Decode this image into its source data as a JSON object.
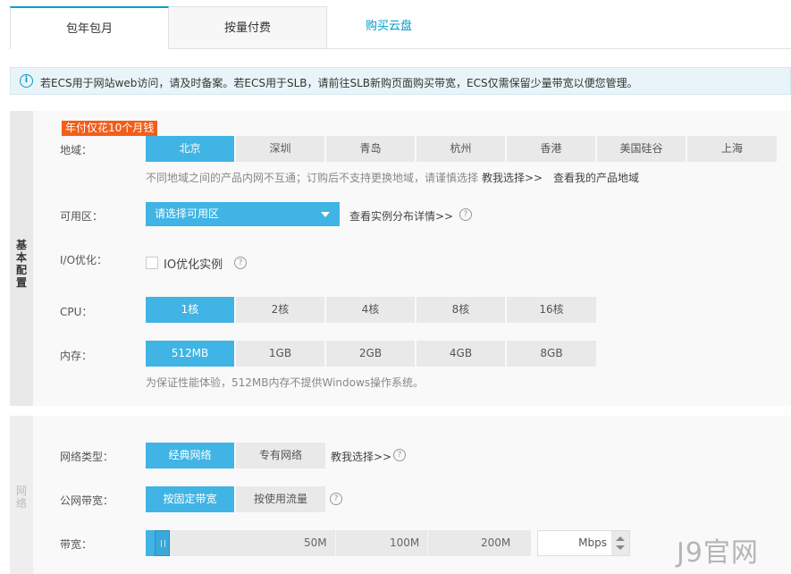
{
  "tabs": [
    {
      "label": "包年包月",
      "active": true
    },
    {
      "label": "按量付费",
      "active": false
    },
    {
      "label": "购买云盘",
      "active": false
    }
  ],
  "notice": {
    "icon": "info-icon",
    "icon_glyph": "i",
    "text": "若ECS用于网站web访问，请及时备案。若ECS用于SLB，请前往SLB新购页面购买带宽，ECS仅需保留少量带宽以便您管理。"
  },
  "basic": {
    "side_label": "基本配置",
    "promo": "年付仅花10个月钱",
    "region": {
      "label": "地域：",
      "options": [
        "北京",
        "深圳",
        "青岛",
        "杭州",
        "香港",
        "美国硅谷",
        "上海"
      ],
      "selected": "北京",
      "hint": "不同地域之间的产品内网不互通；订购后不支持更换地域，请谨慎选择",
      "link1": "教我选择>>",
      "link2": "查看我的产品地域"
    },
    "zone": {
      "label": "可用区：",
      "placeholder": "请选择可用区",
      "link": "查看实例分布详情>>",
      "help": "?"
    },
    "io": {
      "label": "I/O优化：",
      "checkbox_label": "IO优化实例",
      "checked": false,
      "help": "?"
    },
    "cpu": {
      "label": "CPU：",
      "options": [
        "1核",
        "2核",
        "4核",
        "8核",
        "16核"
      ],
      "selected": "1核"
    },
    "memory": {
      "label": "内存：",
      "options": [
        "512MB",
        "1GB",
        "2GB",
        "4GB",
        "8GB"
      ],
      "selected": "512MB",
      "hint": "为保证性能体验，512MB内存不提供Windows操作系统。"
    }
  },
  "network": {
    "side_label": "网络",
    "type": {
      "label": "网络类型：",
      "options": [
        "经典网络",
        "专有网络"
      ],
      "selected": "经典网络",
      "link": "教我选择>>",
      "help": "?"
    },
    "bandwidth_mode": {
      "label": "公网带宽：",
      "options": [
        "按固定带宽",
        "按使用流量"
      ],
      "selected": "按固定带宽",
      "help": "?"
    },
    "bandwidth": {
      "label": "带宽：",
      "marks": [
        "50M",
        "100M",
        "200M"
      ],
      "value": "",
      "unit": "Mbps"
    }
  },
  "watermark": "J9官网",
  "colors": {
    "accent": "#40b4e4",
    "tab_active_border": "#00a2ca",
    "link": "#0099cc",
    "promo": "#f25d19"
  }
}
